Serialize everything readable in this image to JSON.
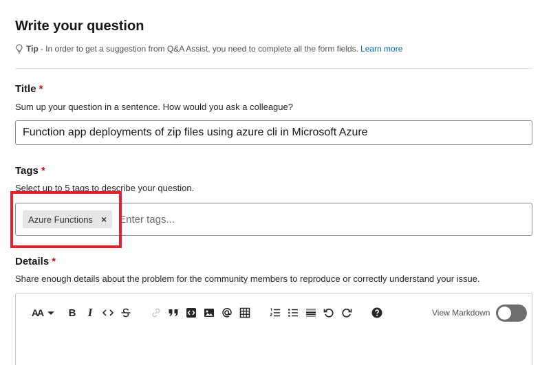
{
  "page": {
    "title": "Write your question"
  },
  "tip": {
    "label": "Tip",
    "text": "- In order to get a suggestion from Q&A Assist, you need to complete all the form fields.",
    "link": "Learn more"
  },
  "title_section": {
    "label": "Title",
    "required_mark": "*",
    "description": "Sum up your question in a sentence. How would you ask a colleague?",
    "value": "Function app deployments of zip files using azure cli in Microsoft Azure"
  },
  "tags_section": {
    "label": "Tags",
    "required_mark": "*",
    "description": "Select up to 5 tags to describe your question.",
    "tags": [
      "Azure Functions"
    ],
    "remove_glyph": "×",
    "placeholder": "Enter tags..."
  },
  "details_section": {
    "label": "Details",
    "required_mark": "*",
    "description": "Share enough details about the problem for the community members to reproduce or correctly understand your issue."
  },
  "editor": {
    "toolbar": {
      "font_size_label": "AA",
      "bold_label": "B",
      "italic_label": "I"
    },
    "view_markdown_label": "View Markdown",
    "view_markdown_on": false
  },
  "colors": {
    "required": "#c50f1f",
    "link": "#0065b3",
    "highlight": "#e3202e",
    "toggle_off": "#6e6e6e"
  }
}
